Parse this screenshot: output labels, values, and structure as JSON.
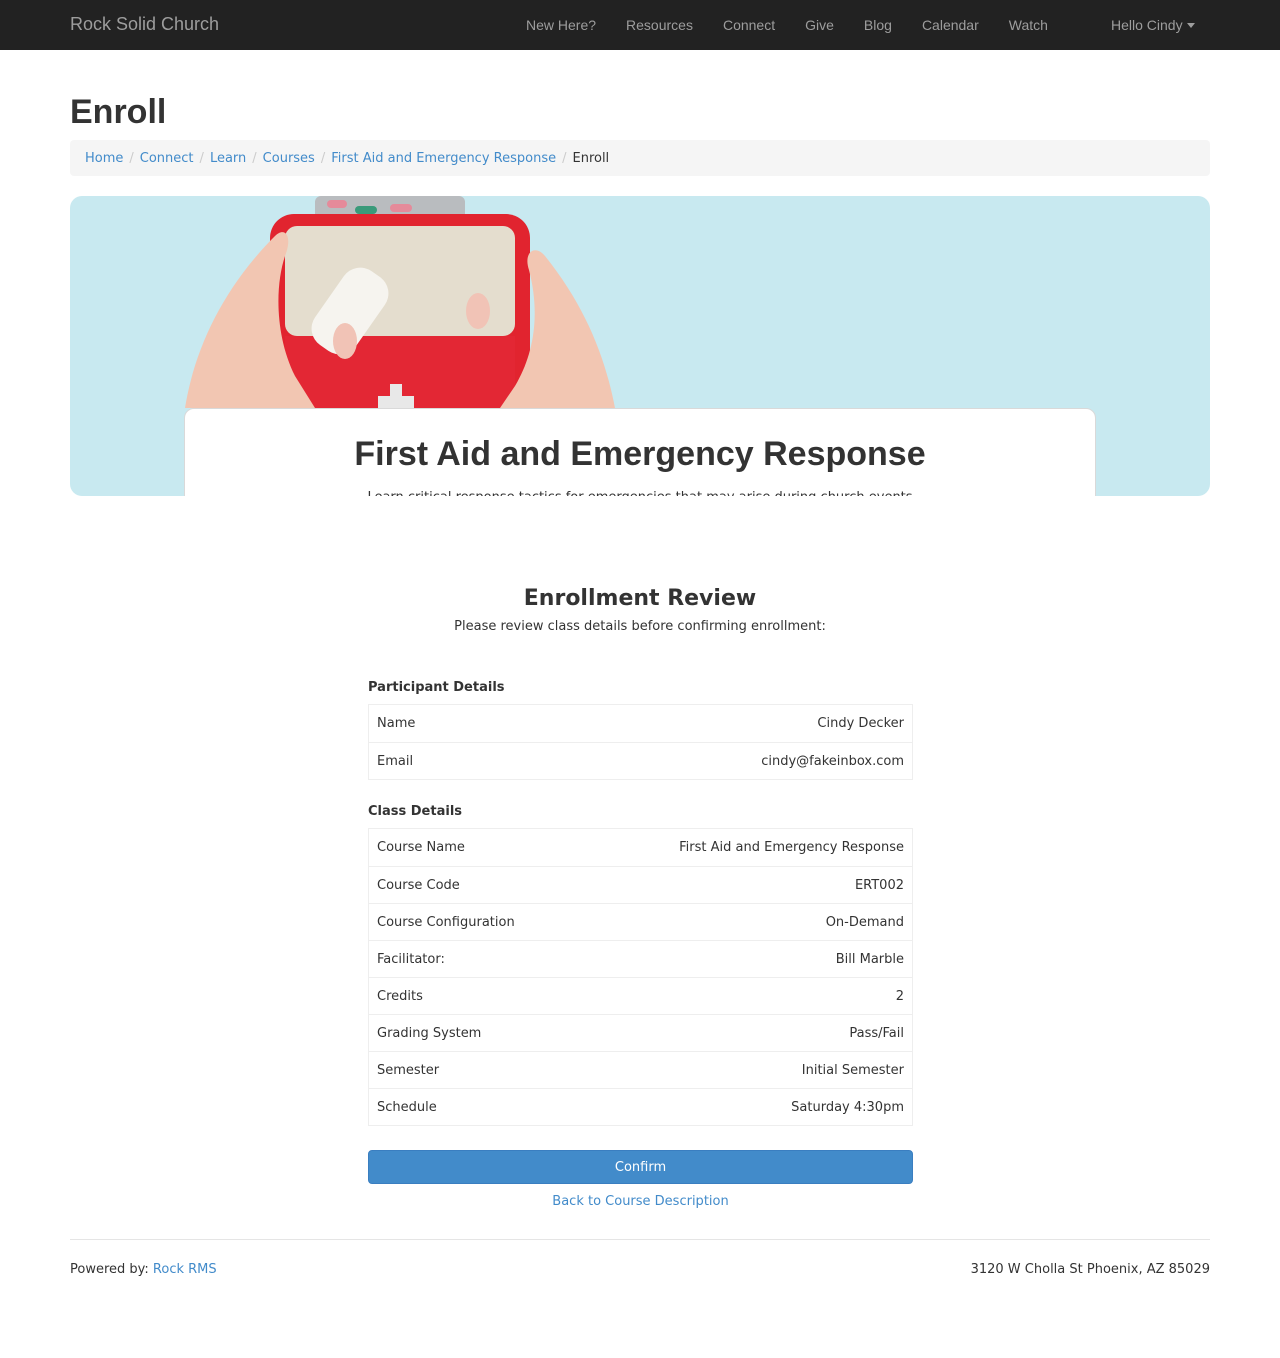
{
  "navbar": {
    "brand": "Rock Solid Church",
    "items": [
      "New Here?",
      "Resources",
      "Connect",
      "Give",
      "Blog",
      "Calendar",
      "Watch"
    ],
    "user_menu": "Hello Cindy"
  },
  "page": {
    "title": "Enroll",
    "breadcrumb": [
      "Home",
      "Connect",
      "Learn",
      "Courses",
      "First Aid and Emergency Response"
    ],
    "breadcrumb_active": "Enroll"
  },
  "hero": {
    "title": "First Aid and Emergency Response",
    "description": "Learn critical response tactics for emergencies that may arise during church events",
    "image": "first-aid-kit-photo",
    "bg_color": "#c8e9f0"
  },
  "review": {
    "title": "Enrollment Review",
    "subtitle": "Please review class details before confirming enrollment:",
    "participant": {
      "label": "Participant Details",
      "rows": [
        {
          "label": "Name",
          "value": "Cindy Decker"
        },
        {
          "label": "Email",
          "value": "cindy@fakeinbox.com"
        }
      ]
    },
    "class": {
      "label": "Class Details",
      "rows": [
        {
          "label": "Course Name",
          "value": "First Aid and Emergency Response"
        },
        {
          "label": "Course Code",
          "value": "ERT002"
        },
        {
          "label": "Course Configuration",
          "value": "On-Demand"
        },
        {
          "label": "Facilitator:",
          "value": "Bill Marble"
        },
        {
          "label": "Credits",
          "value": "2"
        },
        {
          "label": "Grading System",
          "value": "Pass/Fail"
        },
        {
          "label": "Semester",
          "value": "Initial Semester"
        },
        {
          "label": "Schedule",
          "value": "Saturday 4:30pm"
        }
      ]
    },
    "confirm_label": "Confirm",
    "back_label": "Back to Course Description",
    "accent_color": "#428bca"
  },
  "footer": {
    "powered_prefix": "Powered by: ",
    "powered_link": "Rock RMS",
    "address": "3120 W Cholla St Phoenix, AZ 85029"
  }
}
